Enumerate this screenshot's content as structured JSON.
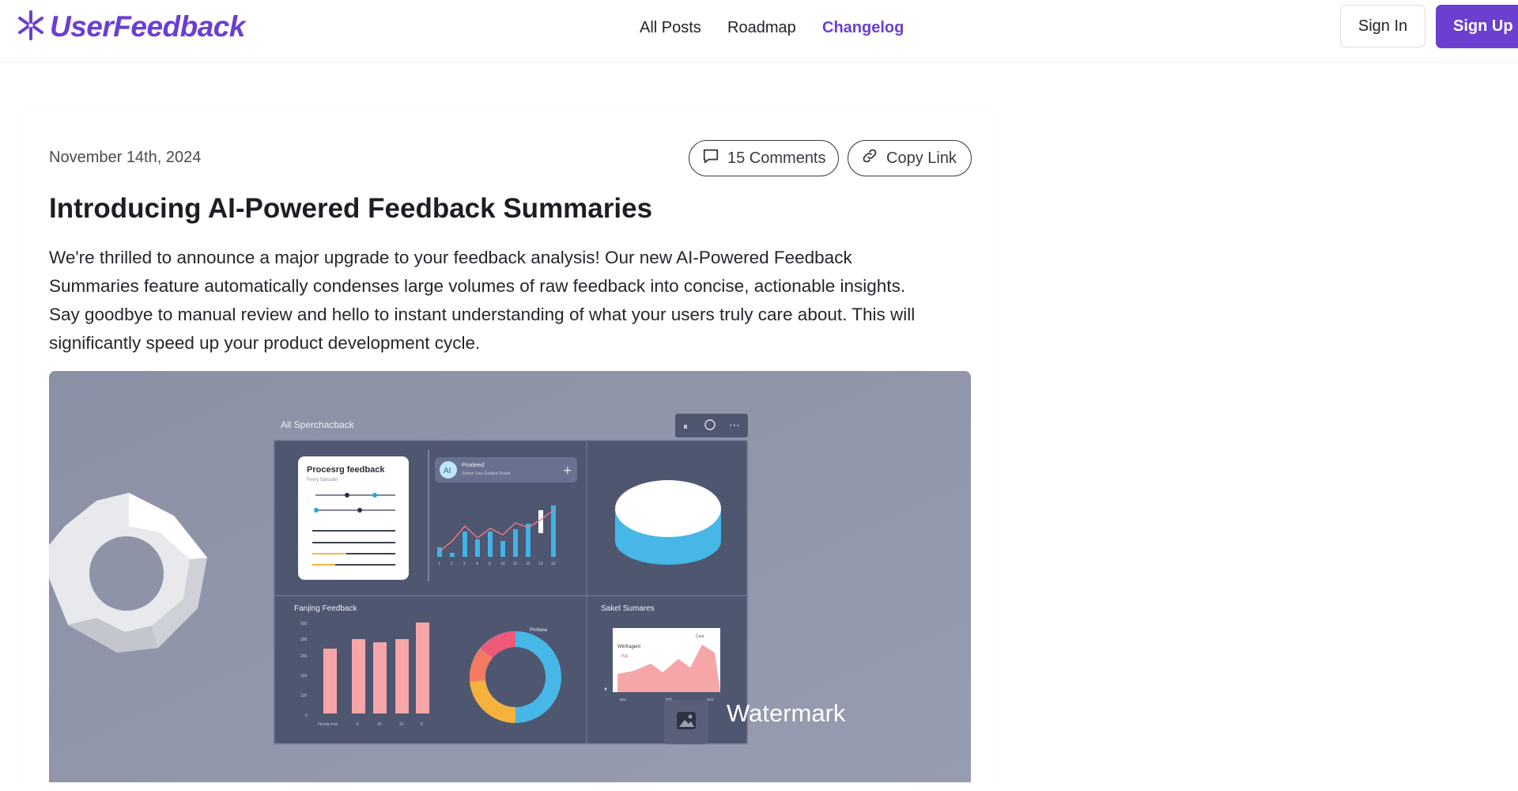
{
  "brand": {
    "name": "UserFeedback",
    "accent": "#6b3fd0"
  },
  "nav": {
    "items": [
      {
        "label": "All Posts",
        "active": false
      },
      {
        "label": "Roadmap",
        "active": false
      },
      {
        "label": "Changelog",
        "active": true
      }
    ]
  },
  "auth": {
    "sign_in": "Sign In",
    "sign_up": "Sign Up"
  },
  "post": {
    "date": "November 14th, 2024",
    "comments_label": "15 Comments",
    "copy_link_label": "Copy Link",
    "title": "Introducing AI-Powered Feedback Summaries",
    "body_lines": [
      "We're thrilled to announce a major upgrade to your feedback analysis! Our new AI-Powered Feedback",
      "Summaries feature automatically condenses large volumes of raw feedback into concise, actionable insights.",
      "Say goodbye to manual review and hello to instant understanding of what your users truly care about. This will",
      "significantly speed up your product development cycle."
    ]
  },
  "hero_image": {
    "dashboard_title": "All Sperchacback",
    "panel_processing_title": "Procesrg feedback",
    "panel_processing_sub": "Fevry Sprouter",
    "panel_ai_badge": "AI",
    "panel_ai_title": "Prodeed",
    "panel_ai_sub": "Ststes Saa Gadiye Rneid",
    "panel_ai_plus": "+",
    "panel_ranking_title": "Fanjing Feedback",
    "panel_donut_label": "Pnrbace",
    "panel_summaries_title": "Sakel Sumares",
    "panel_summaries_card_title": "Wlnfragent",
    "panel_summaries_card_tag": "Cent",
    "panel_summaries_card_legend": "Pull",
    "mini_bar_axis": [
      "1",
      "2",
      "3",
      "4",
      "5",
      "10",
      "11",
      "12",
      "13",
      "13"
    ],
    "bar_axis_y": [
      "500",
      "300",
      "200",
      "200",
      "100",
      "0"
    ],
    "bar_axis_x": [
      "Fluorg sroo",
      "6",
      "10",
      "12",
      "8"
    ],
    "summary_axis": [
      "ans",
      "fold",
      "wrd"
    ],
    "watermark": "Watermark"
  }
}
